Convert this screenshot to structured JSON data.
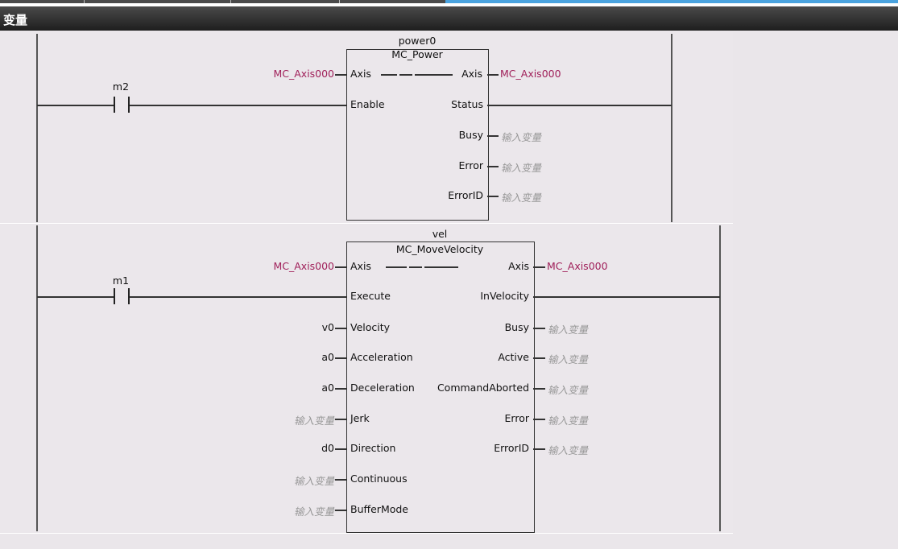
{
  "panel_title": "变量",
  "rung1": {
    "contact": "m2",
    "instance": "power0",
    "type": "MC_Power",
    "inputs": [
      {
        "pin": "Axis",
        "var": "MC_Axis000"
      },
      {
        "pin": "Enable",
        "var": ""
      }
    ],
    "outputs": [
      {
        "pin": "Axis",
        "var": "MC_Axis000"
      },
      {
        "pin": "Status",
        "var": ""
      },
      {
        "pin": "Busy",
        "var": "输入变量"
      },
      {
        "pin": "Error",
        "var": "输入变量"
      },
      {
        "pin": "ErrorID",
        "var": "输入变量"
      }
    ]
  },
  "rung2": {
    "contact": "m1",
    "instance": "vel",
    "type": "MC_MoveVelocity",
    "inputs": [
      {
        "pin": "Axis",
        "var": "MC_Axis000"
      },
      {
        "pin": "Execute",
        "var": ""
      },
      {
        "pin": "Velocity",
        "var": "v0"
      },
      {
        "pin": "Acceleration",
        "var": "a0"
      },
      {
        "pin": "Deceleration",
        "var": "a0"
      },
      {
        "pin": "Jerk",
        "var": "输入变量"
      },
      {
        "pin": "Direction",
        "var": "d0"
      },
      {
        "pin": "Continuous",
        "var": "输入变量"
      },
      {
        "pin": "BufferMode",
        "var": "输入变量"
      }
    ],
    "outputs": [
      {
        "pin": "Axis",
        "var": "MC_Axis000"
      },
      {
        "pin": "InVelocity",
        "var": ""
      },
      {
        "pin": "Busy",
        "var": "输入变量"
      },
      {
        "pin": "Active",
        "var": "输入变量"
      },
      {
        "pin": "CommandAborted",
        "var": "输入变量"
      },
      {
        "pin": "Error",
        "var": "输入变量"
      },
      {
        "pin": "ErrorID",
        "var": "输入变量"
      }
    ]
  }
}
